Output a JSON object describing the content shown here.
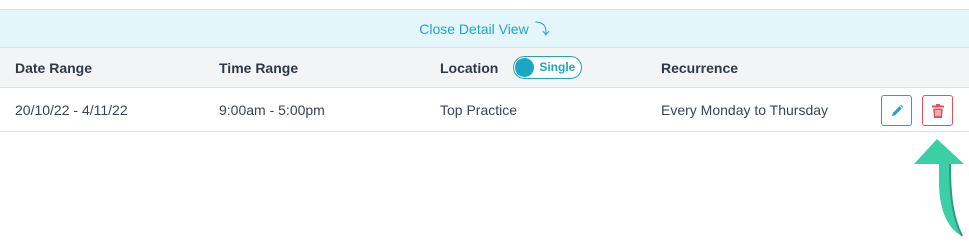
{
  "close_bar": {
    "label": "Close Detail View",
    "icon": "down-arrow-icon"
  },
  "table": {
    "headers": {
      "date_range": "Date Range",
      "time_range": "Time Range",
      "location": "Location",
      "recurrence": "Recurrence"
    },
    "location_toggle": {
      "label": "Single",
      "state": "on"
    },
    "rows": [
      {
        "date_range": "20/10/22 - 4/11/22",
        "time_range": "9:00am - 5:00pm",
        "location": "Top Practice",
        "recurrence": "Every Monday to Thursday"
      }
    ],
    "row_actions": {
      "edit_icon": "pencil-icon",
      "delete_icon": "trash-icon"
    }
  },
  "colors": {
    "accent": "#1ba7c4",
    "danger": "#e2545c",
    "highlight_arrow": "#3ccfa5",
    "header_bg": "#f3f4f5",
    "close_bar_bg": "#e5f6fa"
  }
}
